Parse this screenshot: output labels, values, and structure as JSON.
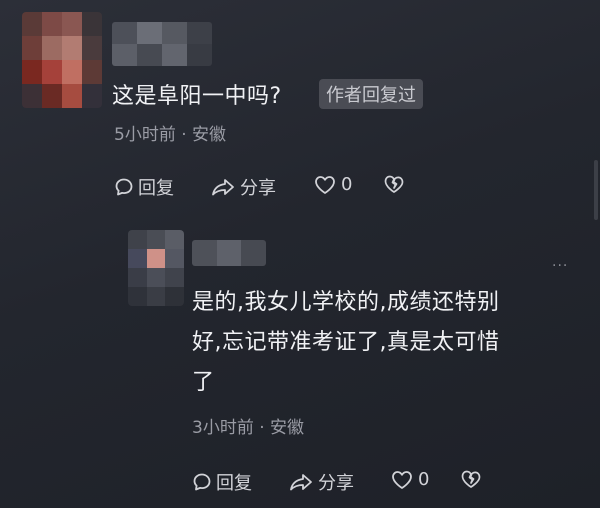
{
  "comment": {
    "text": "这是阜阳一中吗?",
    "author_badge": "作者回复过",
    "meta": "5小时前 · 安徽",
    "actions": {
      "reply": "回复",
      "share": "分享",
      "like_count": "0"
    }
  },
  "reply": {
    "text_line1": "是的,我女儿学校的,成绩还特别",
    "text_line2": "好,忘记带准考证了,真是太可惜",
    "text_line3": "了",
    "meta": "3小时前 · 安徽",
    "more": "···",
    "actions": {
      "reply": "回复",
      "share": "分享",
      "like_count": "0"
    }
  },
  "icons": [
    "chat-bubble-icon",
    "share-arrow-icon",
    "heart-icon",
    "broken-heart-icon",
    "more-dots-icon"
  ],
  "colors": {
    "background": "#262930",
    "text": "#f1f2f5",
    "meta": "#9a9ca5",
    "badge": "#4a4c54"
  }
}
